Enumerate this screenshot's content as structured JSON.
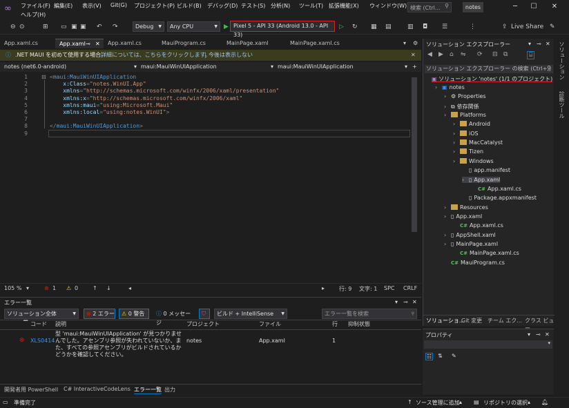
{
  "menubar": {
    "logo": "∞",
    "items": [
      "ファイル(F)",
      "編集(E)",
      "表示(V)",
      "Git(G)",
      "プロジェクト(P)",
      "ビルド(B)",
      "デバッグ(D)",
      "テスト(S)",
      "分析(N)",
      "ツール(T)",
      "拡張機能(X)",
      "ウィンドウ(W)"
    ],
    "help": "ヘルプ(H)",
    "search": "検索 (Ctrl...",
    "solution_badge": "notes",
    "live_share": "Live Share"
  },
  "toolbar": {
    "config": "Debug",
    "platform": "Any CPU",
    "run_target": "Pixel 5 - API 33 (Android 13.0 - API 33)"
  },
  "tabs": [
    {
      "label": "App.xaml.cs",
      "active": false
    },
    {
      "label": "App.xaml",
      "active": true
    },
    {
      "label": "App.xaml.cs",
      "active": false
    },
    {
      "label": "MauiProgram.cs",
      "active": false
    },
    {
      "label": "MainPage.xaml",
      "active": false
    },
    {
      "label": "MainPage.xaml.cs",
      "active": false
    }
  ],
  "infobar": {
    "message": ".NET MAUI を初めて使用する場合",
    "link1": "詳細については、こちらをクリックします。",
    "link2": "今後は表示しない"
  },
  "navbar": {
    "project": "notes (net6.0-android)",
    "type": "maui:MauiWinUIApplication",
    "member": "maui:MauiWinUIApplication"
  },
  "editor": {
    "lines": [
      "1",
      "2",
      "3",
      "4",
      "5",
      "6",
      "7",
      "8",
      "9"
    ],
    "code": [
      [
        {
          "c": "t-punc",
          "t": "<"
        },
        {
          "c": "t-tag",
          "t": "maui:MauiWinUIApplication"
        }
      ],
      [
        {
          "c": "t-attr",
          "t": "    x:Class"
        },
        {
          "c": "t-punc",
          "t": "="
        },
        {
          "c": "t-val",
          "t": "\"notes.WinUI.App\""
        }
      ],
      [
        {
          "c": "t-attr",
          "t": "    xmlns"
        },
        {
          "c": "t-punc",
          "t": "="
        },
        {
          "c": "t-val",
          "t": "\"http://schemas.microsoft.com/winfx/2006/xaml/presentation\""
        }
      ],
      [
        {
          "c": "t-attr",
          "t": "    xmlns:x"
        },
        {
          "c": "t-punc",
          "t": "="
        },
        {
          "c": "t-val",
          "t": "\"http://schemas.microsoft.com/winfx/2006/xaml\""
        }
      ],
      [
        {
          "c": "t-attr",
          "t": "    xmlns:maui"
        },
        {
          "c": "t-punc",
          "t": "="
        },
        {
          "c": "t-val",
          "t": "\"using:Microsoft.Maui\""
        }
      ],
      [
        {
          "c": "t-attr",
          "t": "    xmlns:local"
        },
        {
          "c": "t-punc",
          "t": "="
        },
        {
          "c": "t-val",
          "t": "\"using:notes.WinUI\""
        },
        {
          "c": "t-punc",
          "t": ">"
        }
      ],
      [],
      [
        {
          "c": "t-punc",
          "t": "</"
        },
        {
          "c": "t-tag",
          "t": "maui:MauiWinUIApplication"
        },
        {
          "c": "t-punc",
          "t": ">"
        }
      ],
      []
    ]
  },
  "editor_status": {
    "zoom": "105 %",
    "errors": "1",
    "warnings": "0",
    "line": "行: 9",
    "char": "文字: 1",
    "spc": "SPC",
    "crlf": "CRLF"
  },
  "error_list": {
    "title": "エラー一覧",
    "scope": "ソリューション全体",
    "errors_btn": "2 エラー",
    "warnings_btn": "0 警告",
    "messages_btn": "0 メッセージ",
    "build_filter": "ビルド + IntelliSense",
    "search_placeholder": "エラー一覧を検索",
    "headers": {
      "code": "コード",
      "desc": "説明",
      "project": "プロジェクト",
      "file": "ファイル",
      "line": "行",
      "suppress": "抑制状態"
    },
    "rows": [
      {
        "code": "XLS0414",
        "desc": "型 'maui:MauiWinUIApplication' が見つかりませんでした。アセンブリ参照が失われていないか、また、すべての参照アセンブリがビルドされているかどうかを確認してください。",
        "project": "notes",
        "file": "App.xaml",
        "line": "1"
      }
    ]
  },
  "bottom_tabs": [
    "開発者用 PowerShell",
    "C# Interactive",
    "CodeLens",
    "エラー一覧",
    "出力"
  ],
  "statusbar": {
    "ready": "準備完了",
    "source_control": "ソース管理に追加",
    "repo": "リポジトリの選択"
  },
  "solution_explorer": {
    "title": "ソリューション エクスプローラー",
    "search": "ソリューション エクスプローラー の検索 (Ctrl+;)",
    "solution": "ソリューション 'notes' (1/1 のプロジェクト)",
    "nodes": [
      {
        "label": "notes",
        "depth": 1,
        "kind": "project"
      },
      {
        "label": "Properties",
        "depth": 2,
        "kind": "props"
      },
      {
        "label": "依存関係",
        "depth": 2,
        "kind": "deps"
      },
      {
        "label": "Platforms",
        "depth": 2,
        "kind": "folder"
      },
      {
        "label": "Android",
        "depth": 3,
        "kind": "folder"
      },
      {
        "label": "iOS",
        "depth": 3,
        "kind": "folder"
      },
      {
        "label": "MacCatalyst",
        "depth": 3,
        "kind": "folder"
      },
      {
        "label": "Tizen",
        "depth": 3,
        "kind": "folder"
      },
      {
        "label": "Windows",
        "depth": 3,
        "kind": "folder"
      },
      {
        "label": "app.manifest",
        "depth": 4,
        "kind": "file"
      },
      {
        "label": "App.xaml",
        "depth": 4,
        "kind": "xaml"
      },
      {
        "label": "App.xaml.cs",
        "depth": 5,
        "kind": "cs"
      },
      {
        "label": "Package.appxmanifest",
        "depth": 4,
        "kind": "file"
      },
      {
        "label": "Resources",
        "depth": 2,
        "kind": "folder"
      },
      {
        "label": "App.xaml",
        "depth": 2,
        "kind": "xaml"
      },
      {
        "label": "App.xaml.cs",
        "depth": 3,
        "kind": "cs"
      },
      {
        "label": "AppShell.xaml",
        "depth": 2,
        "kind": "xaml"
      },
      {
        "label": "MainPage.xaml",
        "depth": 2,
        "kind": "xaml"
      },
      {
        "label": "MainPage.xaml.cs",
        "depth": 3,
        "kind": "cs"
      },
      {
        "label": "MauiProgram.cs",
        "depth": 2,
        "kind": "cs"
      }
    ],
    "bottom_tabs": [
      "ソリューショ...",
      "Git 変更",
      "チーム エク...",
      "クラス ビュー"
    ]
  },
  "properties": {
    "title": "プロパティ"
  },
  "right_strip": [
    "ソリューション",
    "診断ツール"
  ],
  "colors": {
    "run_border": "#e02020",
    "accent": "#007acc"
  }
}
